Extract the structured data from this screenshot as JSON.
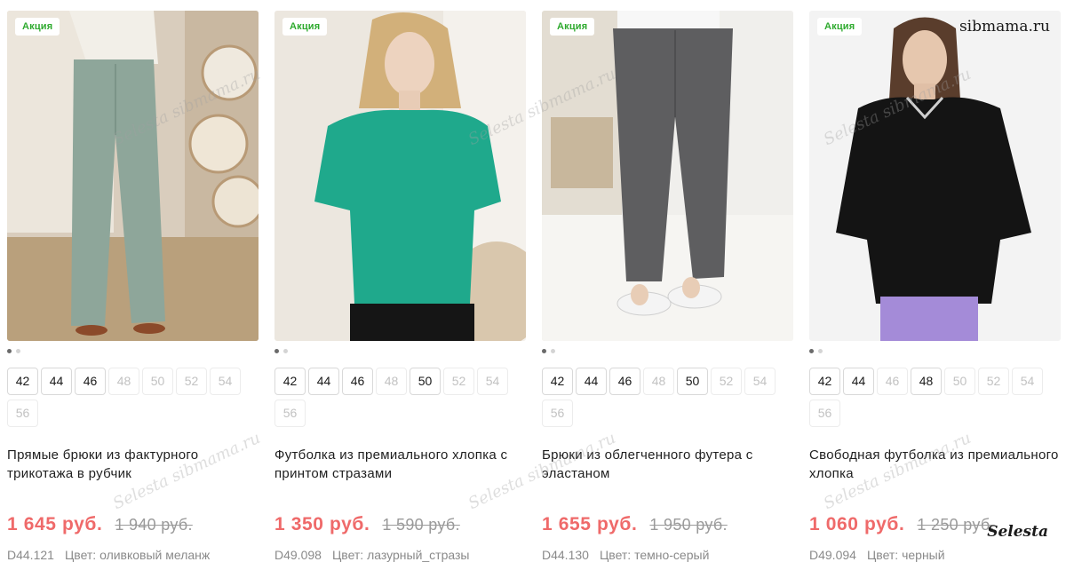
{
  "products": [
    {
      "promo": "Акция",
      "title": "Прямые брюки из фактурного трикотажа в рубчик",
      "price": "1 645 руб.",
      "old_price": "1 940 руб.",
      "sku": "D44.121",
      "color": "Цвет: оливковый меланж",
      "sizes": [
        {
          "label": "42",
          "available": true
        },
        {
          "label": "44",
          "available": true
        },
        {
          "label": "46",
          "available": true
        },
        {
          "label": "48",
          "available": false
        },
        {
          "label": "50",
          "available": false
        },
        {
          "label": "52",
          "available": false
        },
        {
          "label": "54",
          "available": false
        },
        {
          "label": "56",
          "available": false
        }
      ]
    },
    {
      "promo": "Акция",
      "title": "Футболка из премиального хлопка с принтом стразами",
      "price": "1 350 руб.",
      "old_price": "1 590 руб.",
      "sku": "D49.098",
      "color": "Цвет: лазурный_стразы",
      "sizes": [
        {
          "label": "42",
          "available": true
        },
        {
          "label": "44",
          "available": true
        },
        {
          "label": "46",
          "available": true
        },
        {
          "label": "48",
          "available": false
        },
        {
          "label": "50",
          "available": true
        },
        {
          "label": "52",
          "available": false
        },
        {
          "label": "54",
          "available": false
        },
        {
          "label": "56",
          "available": false
        }
      ]
    },
    {
      "promo": "Акция",
      "title": "Брюки из облегченного футера с эластаном",
      "price": "1 655 руб.",
      "old_price": "1 950 руб.",
      "sku": "D44.130",
      "color": "Цвет: темно-серый",
      "sizes": [
        {
          "label": "42",
          "available": true
        },
        {
          "label": "44",
          "available": true
        },
        {
          "label": "46",
          "available": true
        },
        {
          "label": "48",
          "available": false
        },
        {
          "label": "50",
          "available": true
        },
        {
          "label": "52",
          "available": false
        },
        {
          "label": "54",
          "available": false
        },
        {
          "label": "56",
          "available": false
        }
      ]
    },
    {
      "promo": "Акция",
      "title": "Свободная футболка из премиального хлопка",
      "price": "1 060 руб.",
      "old_price": "1 250 руб.",
      "sku": "D49.094",
      "color": "Цвет: черный",
      "sizes": [
        {
          "label": "42",
          "available": true
        },
        {
          "label": "44",
          "available": true
        },
        {
          "label": "46",
          "available": false
        },
        {
          "label": "48",
          "available": true
        },
        {
          "label": "50",
          "available": false
        },
        {
          "label": "52",
          "available": false
        },
        {
          "label": "54",
          "available": false
        },
        {
          "label": "56",
          "available": false
        }
      ]
    }
  ],
  "watermarks": {
    "site": "sibmama.ru",
    "brand": "Selesta",
    "overlay": "Selesta sibmama.ru"
  },
  "colors": {
    "promo_text": "#2eaa2e",
    "price_new": "#ef6a6a",
    "price_old": "#9a9a9a",
    "unavailable_size": "#c2c2c2"
  }
}
